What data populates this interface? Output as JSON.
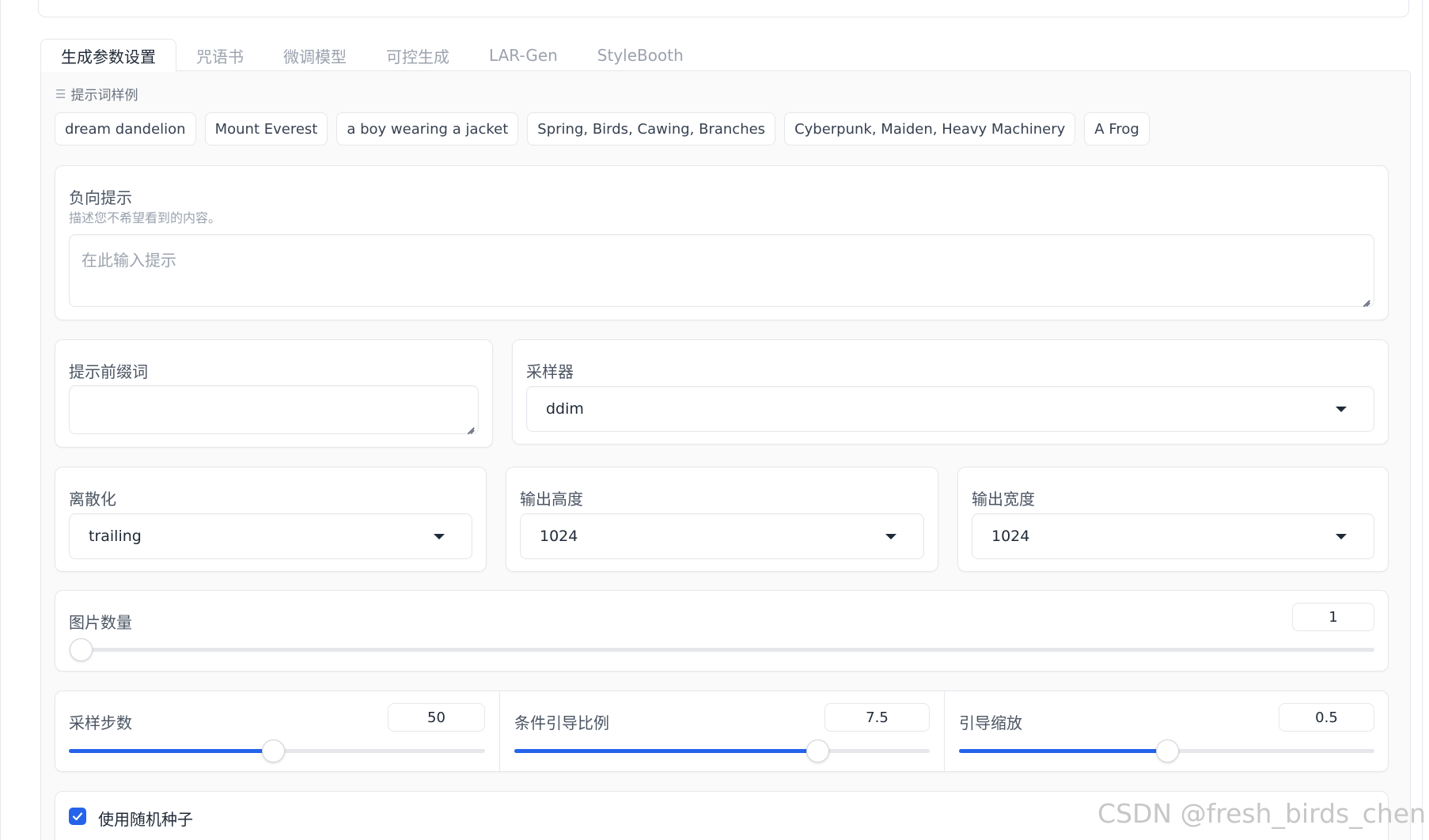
{
  "tabs": [
    {
      "label": "生成参数设置",
      "active": true
    },
    {
      "label": "咒语书"
    },
    {
      "label": "微调模型"
    },
    {
      "label": "可控生成"
    },
    {
      "label": "LAR-Gen"
    },
    {
      "label": "StyleBooth"
    }
  ],
  "examples": {
    "label": "提示词样例",
    "icon": "list-icon",
    "items": [
      "dream dandelion",
      "Mount Everest",
      "a boy wearing a jacket",
      "Spring, Birds, Cawing, Branches",
      "Cyberpunk, Maiden, Heavy Machinery",
      "A Frog"
    ]
  },
  "negative_prompt": {
    "label": "负向提示",
    "description": "描述您不希望看到的内容。",
    "placeholder": "在此输入提示",
    "value": ""
  },
  "prefix": {
    "label": "提示前缀词",
    "value": ""
  },
  "sampler": {
    "label": "采样器",
    "value": "ddim"
  },
  "discretization": {
    "label": "离散化",
    "value": "trailing"
  },
  "output_height": {
    "label": "输出高度",
    "value": "1024"
  },
  "output_width": {
    "label": "输出宽度",
    "value": "1024"
  },
  "image_count": {
    "label": "图片数量",
    "value": "1",
    "fraction": 0.0
  },
  "sample_steps": {
    "label": "采样步数",
    "value": "50",
    "fraction": 0.49
  },
  "guide_ratio": {
    "label": "条件引导比例",
    "value": "7.5",
    "fraction": 0.73
  },
  "guide_rescale": {
    "label": "引导缩放",
    "value": "0.5",
    "fraction": 0.5
  },
  "random_seed": {
    "label": "使用随机种子",
    "checked": true
  },
  "watermark": "CSDN @fresh_birds_chen",
  "colors": {
    "accent": "#2563eb",
    "border": "#e5e7eb",
    "muted": "#9ca3af"
  }
}
